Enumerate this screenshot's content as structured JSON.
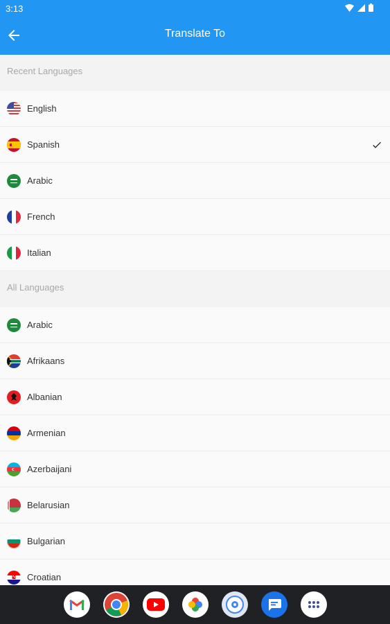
{
  "status_bar": {
    "time": "3:13"
  },
  "header": {
    "title": "Translate To"
  },
  "sections": [
    {
      "title": "Recent Languages",
      "items": [
        {
          "label": "English",
          "flag": "us-flag",
          "selected": false
        },
        {
          "label": "Spanish",
          "flag": "es-flag",
          "selected": true
        },
        {
          "label": "Arabic",
          "flag": "sa-flag",
          "selected": false
        },
        {
          "label": "French",
          "flag": "fr-flag",
          "selected": false
        },
        {
          "label": "Italian",
          "flag": "it-flag",
          "selected": false
        }
      ]
    },
    {
      "title": "All Languages",
      "items": [
        {
          "label": "Arabic",
          "flag": "sa-flag"
        },
        {
          "label": "Afrikaans",
          "flag": "za-flag"
        },
        {
          "label": "Albanian",
          "flag": "al-flag"
        },
        {
          "label": "Armenian",
          "flag": "am-flag"
        },
        {
          "label": "Azerbaijani",
          "flag": "az-flag"
        },
        {
          "label": "Belarusian",
          "flag": "by-flag"
        },
        {
          "label": "Bulgarian",
          "flag": "bg-flag"
        },
        {
          "label": "Croatian",
          "flag": "hr-flag"
        }
      ]
    }
  ],
  "dock": [
    "gmail-icon",
    "chrome-icon",
    "youtube-icon",
    "photos-icon",
    "camera-icon",
    "messages-icon",
    "app-drawer-icon"
  ],
  "colors": {
    "primary": "#2196f3",
    "nav_bar": "#202124",
    "section_bg": "#f3f3f3",
    "row_bg": "#fafafa"
  }
}
